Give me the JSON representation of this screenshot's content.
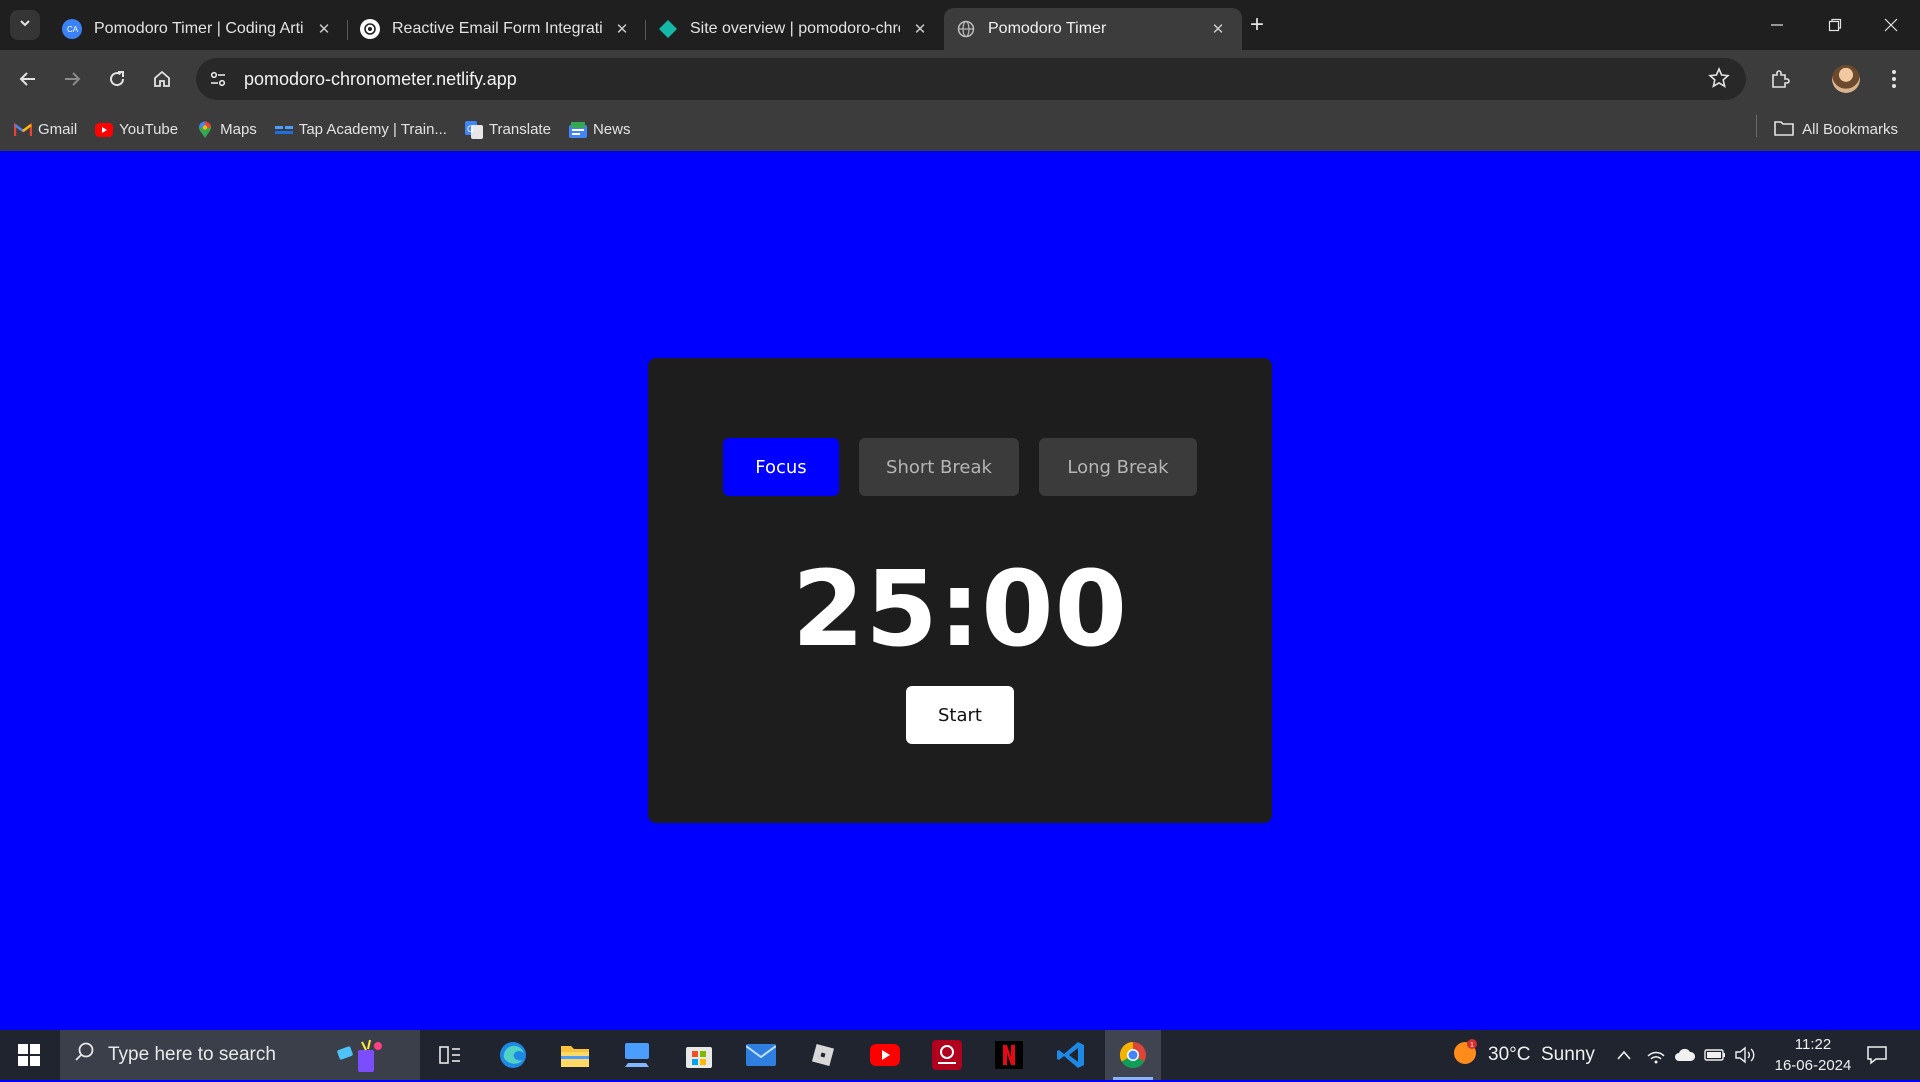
{
  "browser": {
    "tabs": [
      {
        "title": "Pomodoro Timer | Coding Artist",
        "favicon": "coding-artist-icon",
        "active": false
      },
      {
        "title": "Reactive Email Form Integration",
        "favicon": "chatgpt-icon",
        "active": false
      },
      {
        "title": "Site overview | pomodoro-chronometer",
        "favicon": "netlify-icon",
        "active": false
      },
      {
        "title": "Pomodoro Timer",
        "favicon": "globe-icon",
        "active": true
      }
    ],
    "url": "pomodoro-chronometer.netlify.app",
    "bookmarks": [
      {
        "label": "Gmail",
        "icon": "gmail-icon"
      },
      {
        "label": "YouTube",
        "icon": "youtube-icon"
      },
      {
        "label": "Maps",
        "icon": "maps-icon"
      },
      {
        "label": "Tap Academy | Train...",
        "icon": "tap-academy-icon"
      },
      {
        "label": "Translate",
        "icon": "translate-icon"
      },
      {
        "label": "News",
        "icon": "news-icon"
      }
    ],
    "all_bookmarks": "All Bookmarks"
  },
  "app": {
    "background_color": "#0000ff",
    "card_color": "#1d1d1d",
    "modes": [
      {
        "label": "Focus",
        "active": true
      },
      {
        "label": "Short Break",
        "active": false
      },
      {
        "label": "Long Break",
        "active": false
      }
    ],
    "timer": "25:00",
    "start_label": "Start"
  },
  "taskbar": {
    "search_placeholder": "Type here to search",
    "apps": [
      "task-view-icon",
      "edge-icon",
      "file-explorer-icon",
      "remote-desktop-icon",
      "microsoft-store-icon",
      "mail-icon",
      "roblox-icon",
      "youtube-icon",
      "airtel-xstream-icon",
      "netflix-icon",
      "vscode-icon",
      "chrome-icon"
    ],
    "weather": "30°C  Sunny",
    "time": "11:22",
    "date": "16-06-2024"
  }
}
